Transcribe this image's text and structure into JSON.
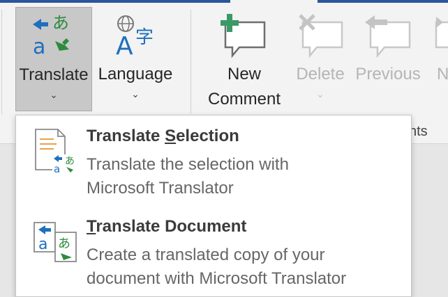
{
  "ribbon": {
    "translate_label": "Translate",
    "language_label": "Language",
    "new_comment_line1": "New",
    "new_comment_line2": "Comment",
    "delete_label": "Delete",
    "previous_label": "Previous",
    "next_label_partial": "N",
    "group_label_partial": "nts",
    "caret": "⌄"
  },
  "menu": {
    "items": [
      {
        "title_pre": "Translate ",
        "title_key": "S",
        "title_post": "election",
        "desc_line1": "Translate the selection with",
        "desc_line2": "Microsoft Translator"
      },
      {
        "title_pre": "",
        "title_key": "T",
        "title_post": "ranslate Document",
        "desc_line1": "Create a translated copy of your",
        "desc_line2": "document with Microsoft Translator"
      }
    ]
  },
  "colors": {
    "accent_blue": "#2b579a",
    "icon_blue": "#1f6fbf",
    "icon_green": "#2e8b3e",
    "active_bg": "#c8c8c8"
  }
}
